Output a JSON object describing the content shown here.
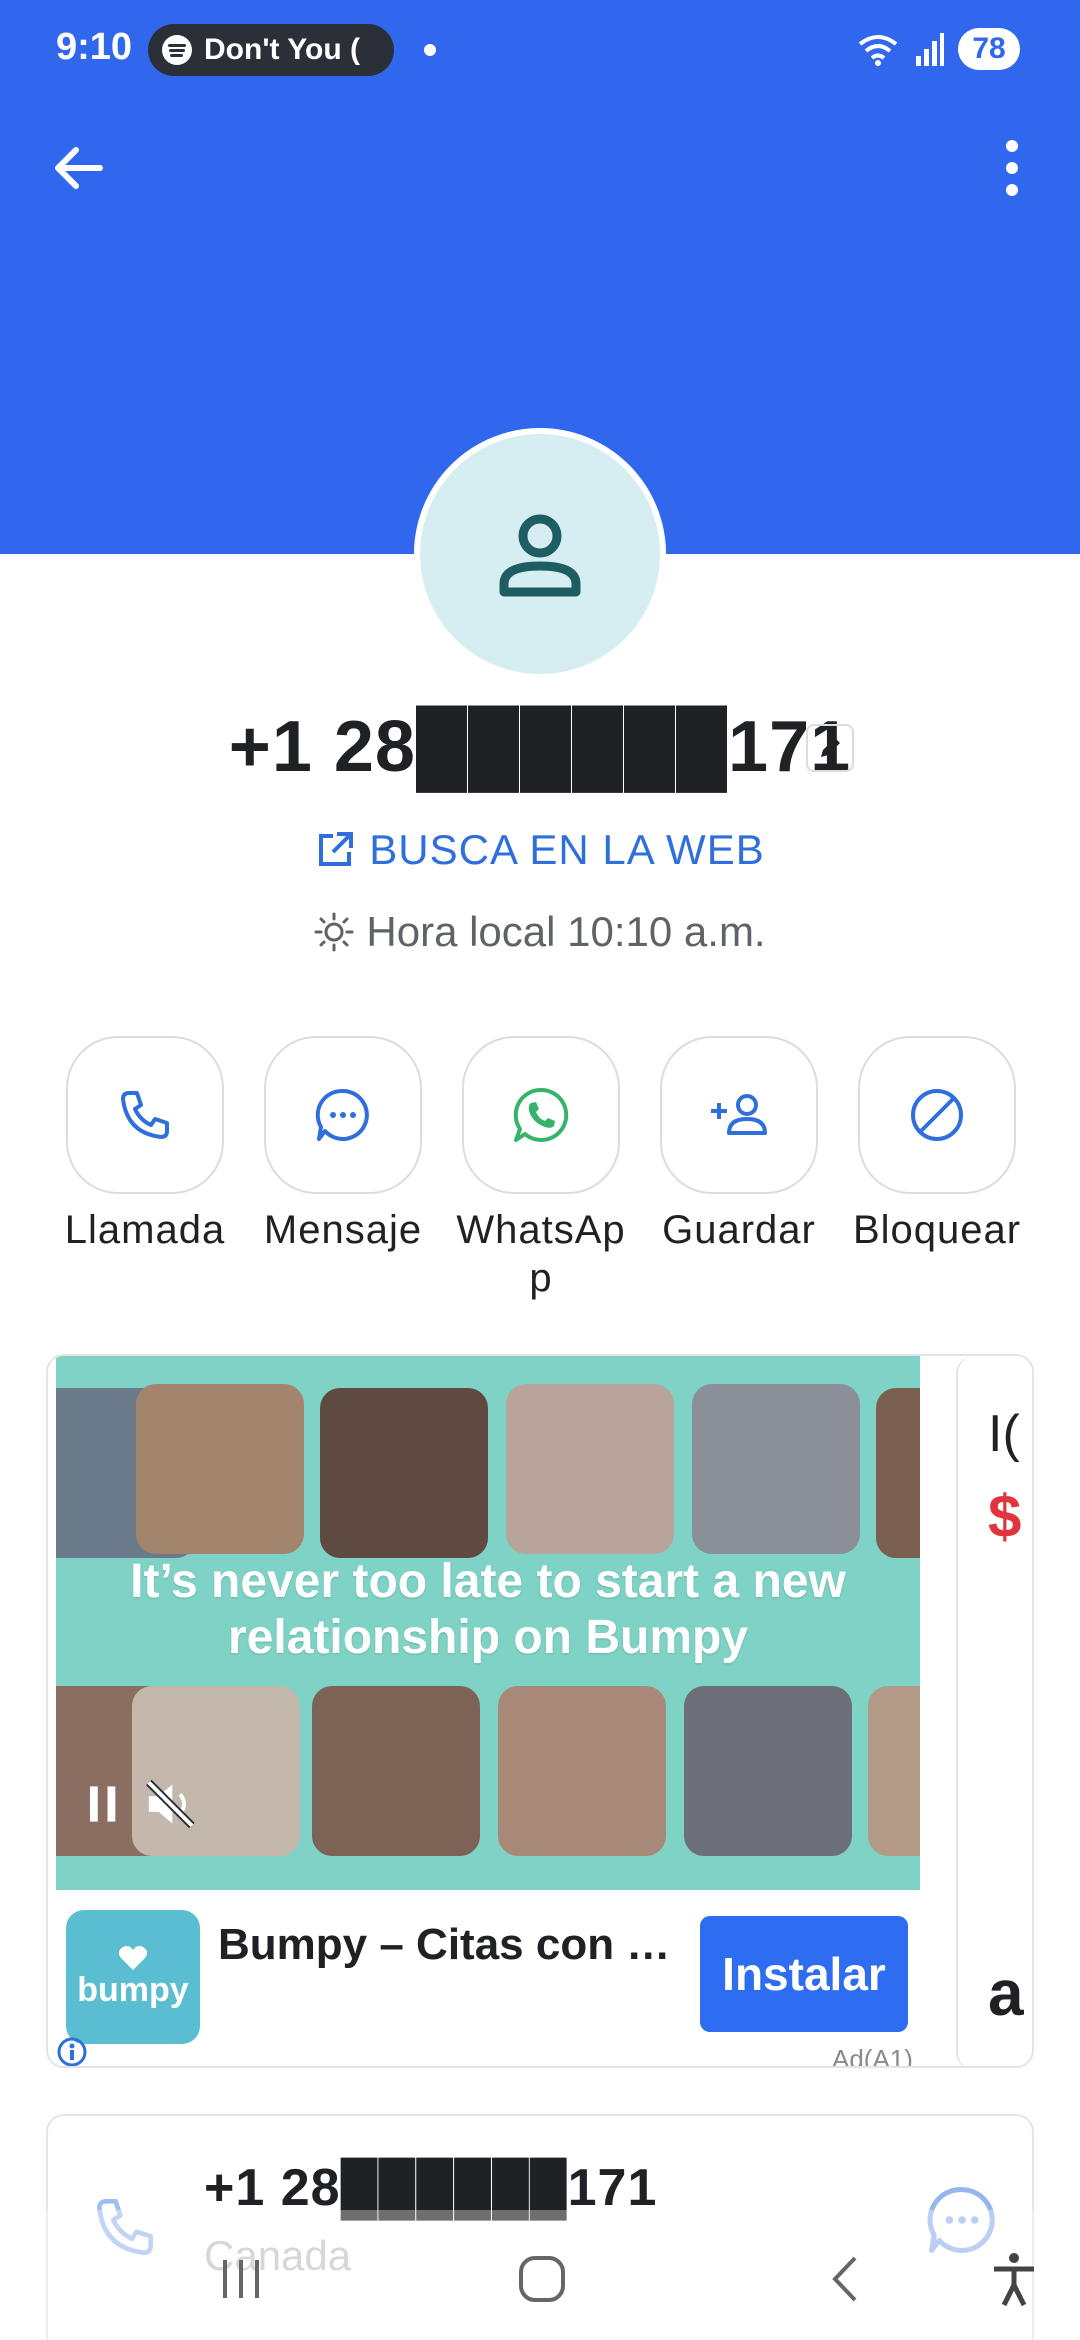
{
  "status_bar": {
    "time": "9:10",
    "media_text": "Don't You (",
    "battery": "78"
  },
  "contact": {
    "phone_number": "+1 28██████171",
    "web_search_label": "BUSCA EN LA WEB",
    "local_time": "Hora local 10:10 a.m."
  },
  "actions": [
    {
      "label": "Llamada",
      "icon": "phone-icon"
    },
    {
      "label": "Mensaje",
      "icon": "message-icon"
    },
    {
      "label": "WhatsAp\np",
      "icon": "whatsapp-icon"
    },
    {
      "label": "Guardar",
      "icon": "add-person-icon"
    },
    {
      "label": "Bloquear",
      "icon": "block-icon"
    }
  ],
  "ad": {
    "headline": "It’s never too late to start a new relationship on Bumpy",
    "app_name": "Bumpy – Citas con …",
    "logo_text": "bumpy",
    "install_label": "Instalar",
    "ad_tag": "Ad(A1)",
    "next_card_text1": "I(",
    "next_card_text2": "$",
    "next_card_text3": "a"
  },
  "info_card": {
    "number": "+1 28██████171",
    "country": "Canada"
  },
  "colors": {
    "header_blue": "#3067ec",
    "link_blue": "#2f6fdc",
    "whatsapp_green": "#34b36a",
    "avatar_bg": "#d6eef1",
    "ad_teal": "#7fd3c6"
  }
}
